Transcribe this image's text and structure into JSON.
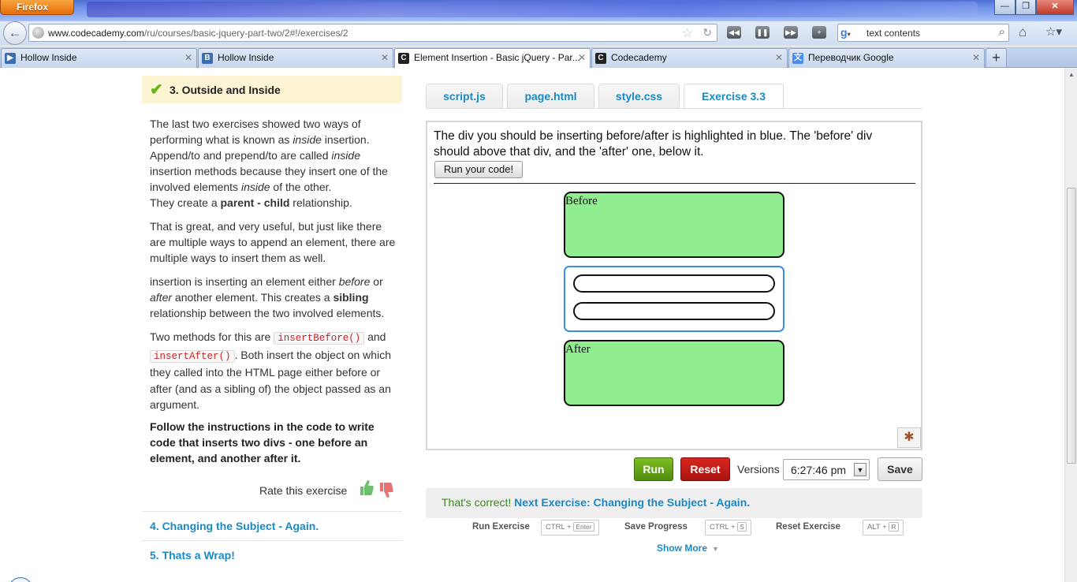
{
  "browser": {
    "menu_label": "Firefox",
    "url_host": "www.codecademy.com",
    "url_path": "/ru/courses/basic-jquery-part-two/2#!/exercises/2",
    "search_engine_icon": "google-icon",
    "search_value": "text contents",
    "tabs": [
      {
        "label": "Hollow Inside",
        "favicon": "HI",
        "color": "#3b6db0"
      },
      {
        "label": "Hollow Inside",
        "favicon": "B",
        "color": "#3b6db0"
      },
      {
        "label": "Element Insertion - Basic jQuery - Par...",
        "favicon": "C",
        "color": "#222222",
        "active": true
      },
      {
        "label": "Codecademy",
        "favicon": "C",
        "color": "#222222"
      },
      {
        "label": "Переводчик Google",
        "favicon": "文",
        "color": "#4a8af4"
      }
    ],
    "new_tab_label": "+"
  },
  "lesson": {
    "title": "3. Outside and Inside",
    "p1_a": "The last two exercises showed two ways of performing what is known as ",
    "p1_inside1": "inside",
    "p1_b": " insertion. Append/to and prepend/to are called ",
    "p1_inside2": "inside",
    "p1_c": " insertion methods because they insert one of the involved elements ",
    "p1_inside3": "inside",
    "p1_d": " of the other.",
    "p1_e": "They create a ",
    "p1_bold": "parent - child",
    "p1_f": " relationship.",
    "p2": "That is great, and very useful, but just like there are multiple ways to append an element, there are multiple ways to insert them as well.",
    "p3_a": "insertion is inserting an element either ",
    "p3_before": "before",
    "p3_or": " or ",
    "p3_after": "after",
    "p3_b": " another element. This creates a ",
    "p3_bold": "sibling",
    "p3_c": " relationship between the two involved elements.",
    "p4_a": "Two methods for this are ",
    "p4_code1": "insertBefore()",
    "p4_b": " and ",
    "p4_code2": "insertAfter()",
    "p4_c": ". Both insert the object on which they called into the HTML page either before or after (and as a sibling of) the object passed as an argument.",
    "instructions": "Follow the instructions in the code to write code that inserts two divs - one before an element, and another after it.",
    "rate_label": "Rate this exercise",
    "next_items": [
      "4. Changing the Subject - Again.",
      "5. Thats a Wrap!"
    ]
  },
  "editor": {
    "tabs": [
      "script.js",
      "page.html",
      "style.css",
      "Exercise 3.3"
    ],
    "active_tab": "Exercise 3.3",
    "preview_instruction": "The div you should be inserting before/after is highlighted in blue. The 'before' div should above that div, and the 'after' one, below it.",
    "run_code_label": "Run your code!",
    "before_label": "Before",
    "after_label": "After",
    "run_label": "Run",
    "reset_label": "Reset",
    "versions_label": "Versions",
    "version_value": "6:27:46 pm",
    "save_label": "Save",
    "correct_text": "That's correct!",
    "next_exercise_text": "Next Exercise: Changing the Subject - Again.",
    "shortcuts": [
      {
        "label": "Run Exercise",
        "key_prefix": "CTRL +",
        "key": "Enter"
      },
      {
        "label": "Save Progress",
        "key_prefix": "CTRL +",
        "key": "S"
      },
      {
        "label": "Reset Exercise",
        "key_prefix": "ALT +",
        "key": "R"
      }
    ],
    "show_more_label": "Show More"
  },
  "colors": {
    "accent_blue": "#1a8ac6",
    "run_green": "#6aa91a",
    "reset_red": "#c11e17",
    "preview_box_green": "#90ee90",
    "highlight_blue": "#3a8ee6",
    "lesson_header_bg": "#fcf4d2"
  }
}
